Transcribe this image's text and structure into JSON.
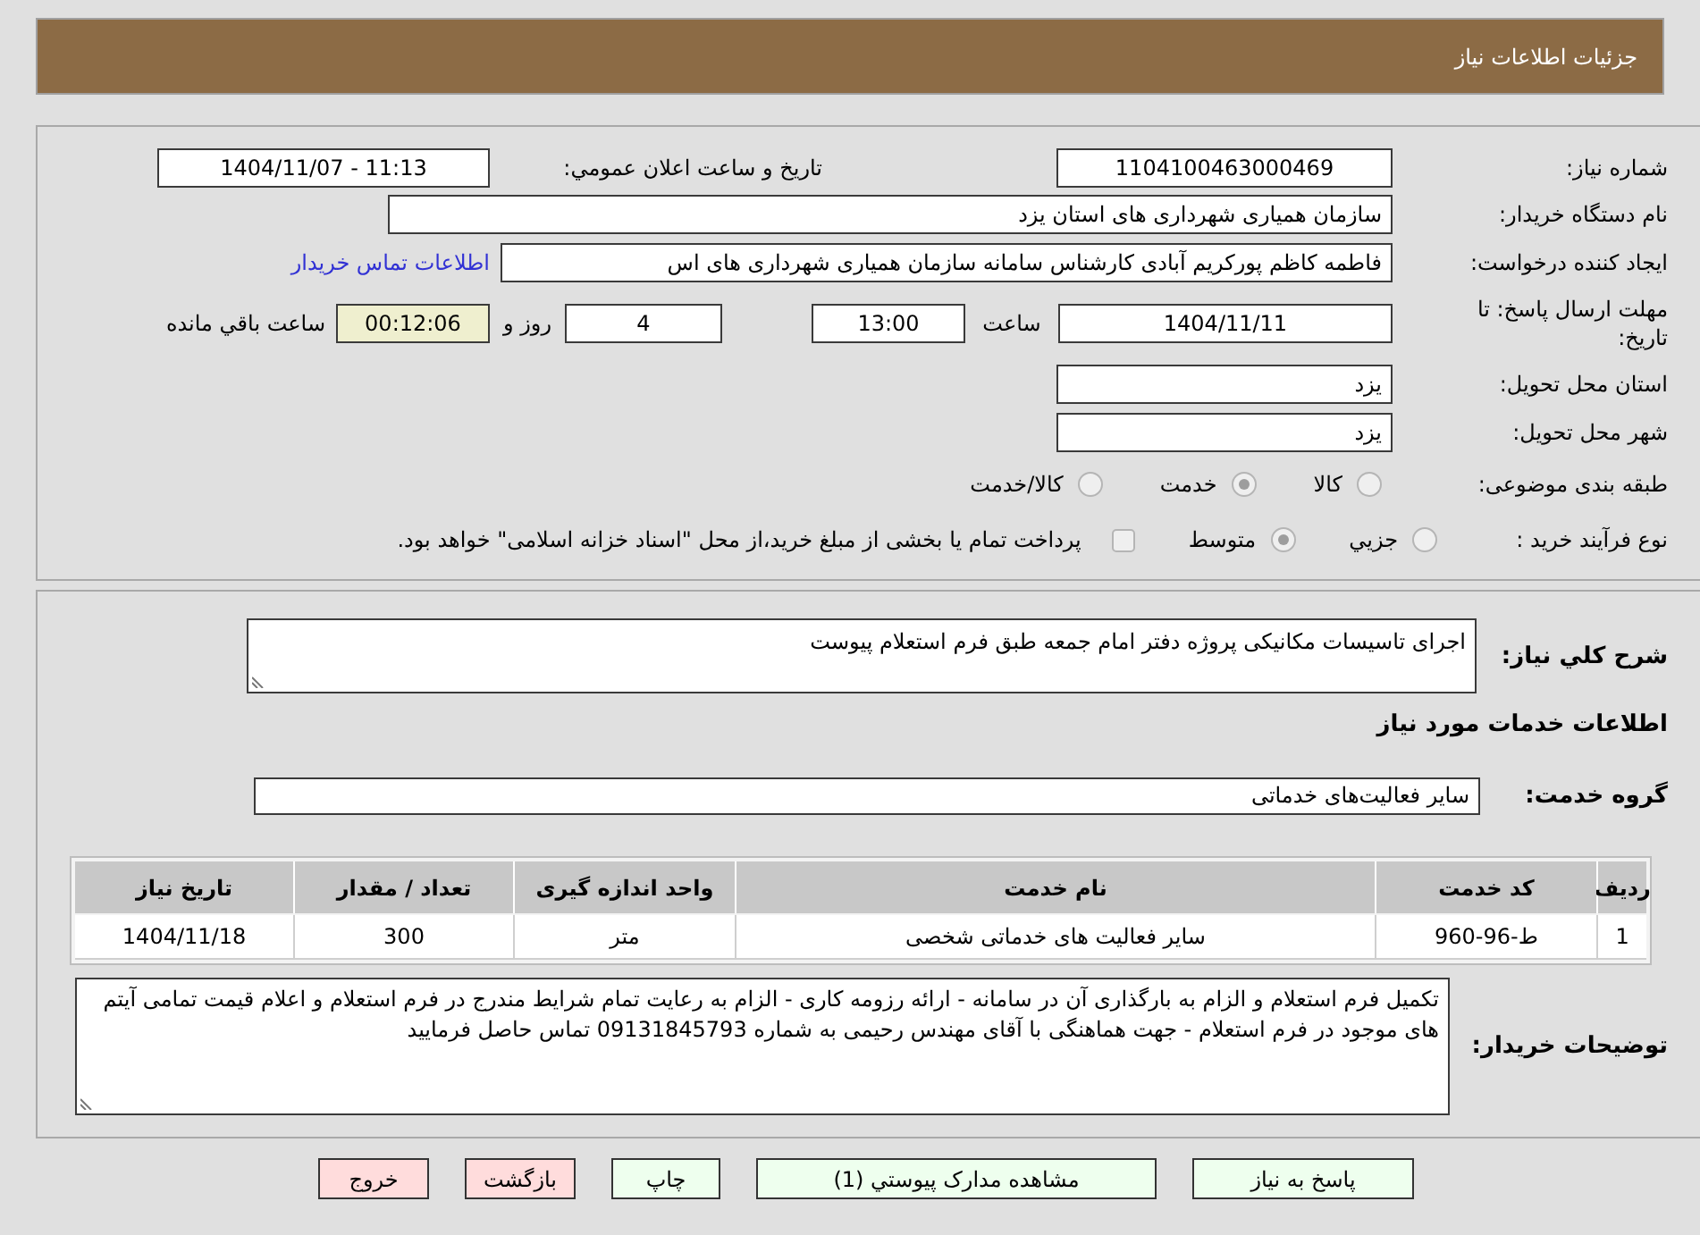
{
  "header": {
    "title": "جزئیات اطلاعات نیاز"
  },
  "details": {
    "need_number": {
      "label": "شماره نیاز:",
      "value": "1104100463000469"
    },
    "announce_datetime": {
      "label": "تاریخ و ساعت اعلان عمومي:",
      "value": "1404/11/07 - 11:13"
    },
    "buyer_org": {
      "label": "نام دستگاه خریدار:",
      "value": "سازمان همیاری شهرداری های استان یزد"
    },
    "requester": {
      "label": "ایجاد کننده درخواست:",
      "value": "فاطمه کاظم پورکریم آبادی کارشناس سامانه سازمان همیاری شهرداری های اس",
      "link": "اطلاعات تماس خریدار"
    },
    "deadline": {
      "label": "مهلت ارسال پاسخ: تا تاریخ:",
      "date": "1404/11/11",
      "time_label": "ساعت",
      "time": "13:00",
      "days": "4",
      "days_label": "روز و",
      "remaining": "00:12:06",
      "remaining_label": "ساعت باقي مانده"
    },
    "province": {
      "label": "استان محل تحویل:",
      "value": "یزد"
    },
    "city": {
      "label": "شهر محل تحویل:",
      "value": "یزد"
    },
    "category": {
      "label": "طبقه بندی موضوعی:",
      "options": [
        {
          "label": "کالا",
          "selected": false,
          "disabled": true
        },
        {
          "label": "خدمت",
          "selected": true,
          "disabled": true
        },
        {
          "label": "کالا/خدمت",
          "selected": false,
          "disabled": true
        }
      ]
    },
    "purchase_type": {
      "label": "نوع فرآیند خرید :",
      "options": [
        {
          "label": "جزيي",
          "selected": false,
          "disabled": true
        },
        {
          "label": "متوسط",
          "selected": true,
          "disabled": true
        }
      ],
      "treasury_payment": {
        "label": "پرداخت تمام یا بخشی از مبلغ خرید،از محل \"اسناد خزانه اسلامی\" خواهد بود.",
        "checked": false,
        "disabled": true
      }
    }
  },
  "services": {
    "summary": {
      "label": "شرح کلي نیاز:",
      "value": "اجرای تاسیسات مکانیکی پروژه دفتر امام جمعه طبق فرم استعلام پیوست"
    },
    "heading": "اطلاعات خدمات مورد نیاز",
    "service_group": {
      "label": "گروه خدمت:",
      "value": "سایر فعالیت‌های خدماتی"
    },
    "table": {
      "columns": [
        "ردیف",
        "کد خدمت",
        "نام خدمت",
        "واحد اندازه گیری",
        "تعداد / مقدار",
        "تاریخ نیاز"
      ],
      "rows": [
        [
          "1",
          "ط-96-960",
          "سایر فعالیت های خدماتی شخصی",
          "متر",
          "300",
          "1404/11/18"
        ]
      ]
    },
    "buyer_notes": {
      "label": "توضیحات خریدار:",
      "value": "تکمیل فرم استعلام و الزام به بارگذاری آن در سامانه - ارائه رزومه کاری - الزام به رعایت تمام شرایط مندرج در فرم استعلام و اعلام قیمت تمامی آیتم های موجود در فرم استعلام - جهت هماهنگی با آقای مهندس رحیمی به شماره 09131845793 تماس حاصل فرمایید"
    }
  },
  "buttons": [
    {
      "label": "پاسخ به نیاز",
      "kind": "positive"
    },
    {
      "label": "مشاهده مدارک پیوستي (1)",
      "kind": "positive"
    },
    {
      "label": "چاپ",
      "kind": "positive"
    },
    {
      "label": "بازگشت",
      "kind": "negative"
    },
    {
      "label": "خروج",
      "kind": "negative"
    }
  ]
}
